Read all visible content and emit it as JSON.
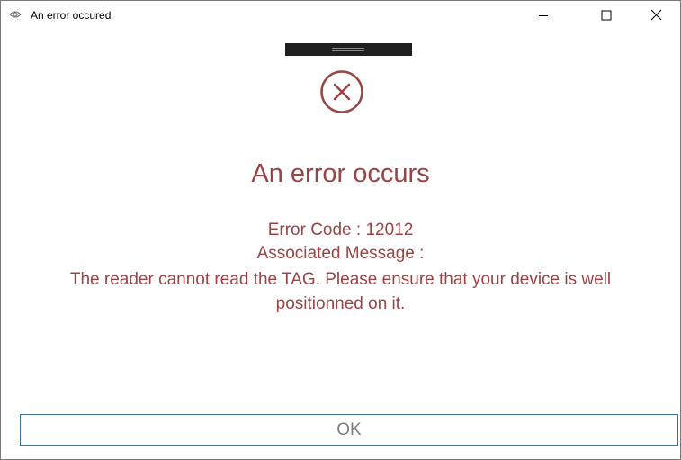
{
  "window": {
    "title": "An error occured",
    "controls": {
      "minimize_icon": "minimize-icon",
      "maximize_icon": "maximize-icon",
      "close_icon": "close-icon"
    }
  },
  "dialog": {
    "icon": "error-circle-x-icon",
    "heading": "An error occurs",
    "error_code_line": "Error Code : 12012",
    "associated_label": "Associated Message :",
    "message_line1": "The reader cannot read the TAG. Please ensure that your device is well",
    "message_line2": "positionned on it.",
    "ok_label": "OK"
  },
  "colors": {
    "error_text": "#9b4444",
    "ok_button_border": "#3d6f9b",
    "ok_button_text": "#7d7d7d",
    "handle": "#1f1f1f"
  }
}
